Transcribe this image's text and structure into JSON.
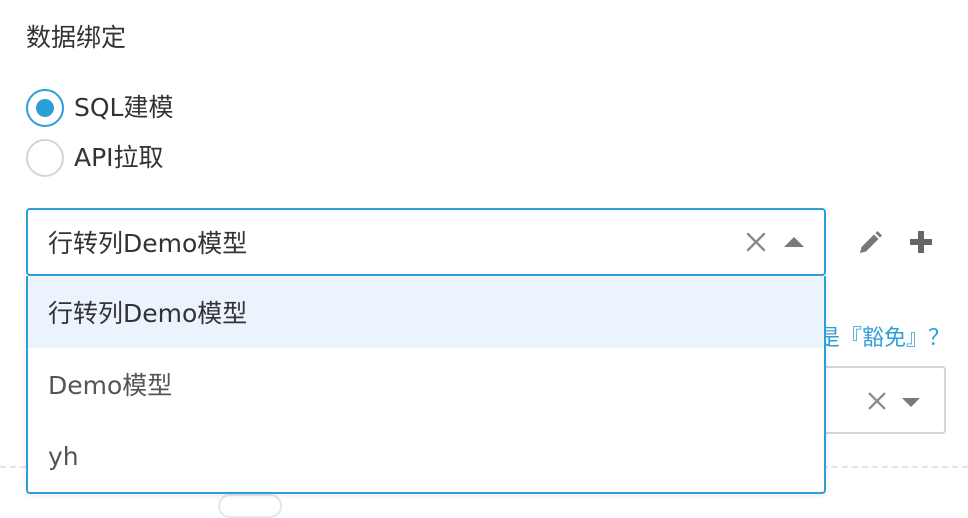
{
  "section_title": "数据绑定",
  "radios": [
    {
      "label": "SQL建模",
      "checked": true
    },
    {
      "label": "API拉取",
      "checked": false
    }
  ],
  "model_select": {
    "value": "行转列Demo模型",
    "clear_icon": "close-icon",
    "toggle_icon": "caret-up-icon"
  },
  "tools": {
    "edit_icon": "pencil-icon",
    "add_icon": "plus-icon"
  },
  "dropdown_options": [
    {
      "label": "行转列Demo模型",
      "active": true
    },
    {
      "label": "Demo模型",
      "active": false
    },
    {
      "label": "yh",
      "active": false
    }
  ],
  "partial_link": "是『豁免』？",
  "colors": {
    "accent": "#2d9fd8",
    "hover_bg": "#ebf4fd",
    "border": "#cfd6dc"
  }
}
